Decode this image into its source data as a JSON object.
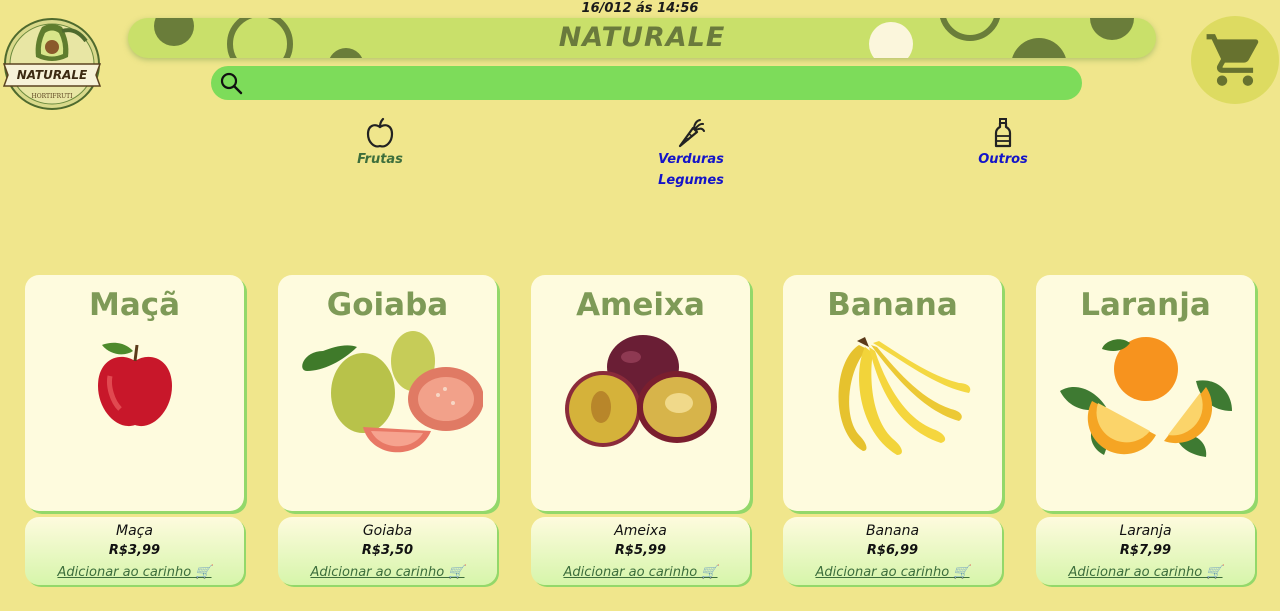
{
  "header": {
    "datetime": "16/012 ás 14:56",
    "brand": "NATURALE",
    "logo_text": "NATURALE",
    "logo_subtext": "HORTIFRUTI"
  },
  "search": {
    "placeholder": "",
    "value": ""
  },
  "categories": [
    {
      "label": "Frutas",
      "icon": "apple-icon",
      "color": "#3d6e3c"
    },
    {
      "label": "Verduras",
      "label2": "Legumes",
      "icon": "carrot-icon",
      "color": "#1414c8"
    },
    {
      "label": "Outros",
      "icon": "bottle-icon",
      "color": "#1414c8"
    }
  ],
  "products": [
    {
      "title": "Maçã",
      "name": "Maça",
      "price": "R$3,99",
      "add_label": "Adicionar ao carinho 🛒"
    },
    {
      "title": "Goiaba",
      "name": "Goiaba",
      "price": "R$3,50",
      "add_label": "Adicionar ao carinho 🛒"
    },
    {
      "title": "Ameixa",
      "name": "Ameixa",
      "price": "R$5,99",
      "add_label": "Adicionar ao carinho 🛒"
    },
    {
      "title": "Banana",
      "name": "Banana",
      "price": "R$6,99",
      "add_label": "Adicionar ao carinho 🛒"
    },
    {
      "title": "Laranja",
      "name": "Laranja",
      "price": "R$7,99",
      "add_label": "Adicionar ao carinho 🛒"
    }
  ],
  "colors": {
    "background": "#f0e68c",
    "banner": "#c9e06a",
    "search": "#7ddc5a",
    "card": "#fefbde",
    "card_title": "#7e9a57",
    "link": "#3d6e3c"
  }
}
